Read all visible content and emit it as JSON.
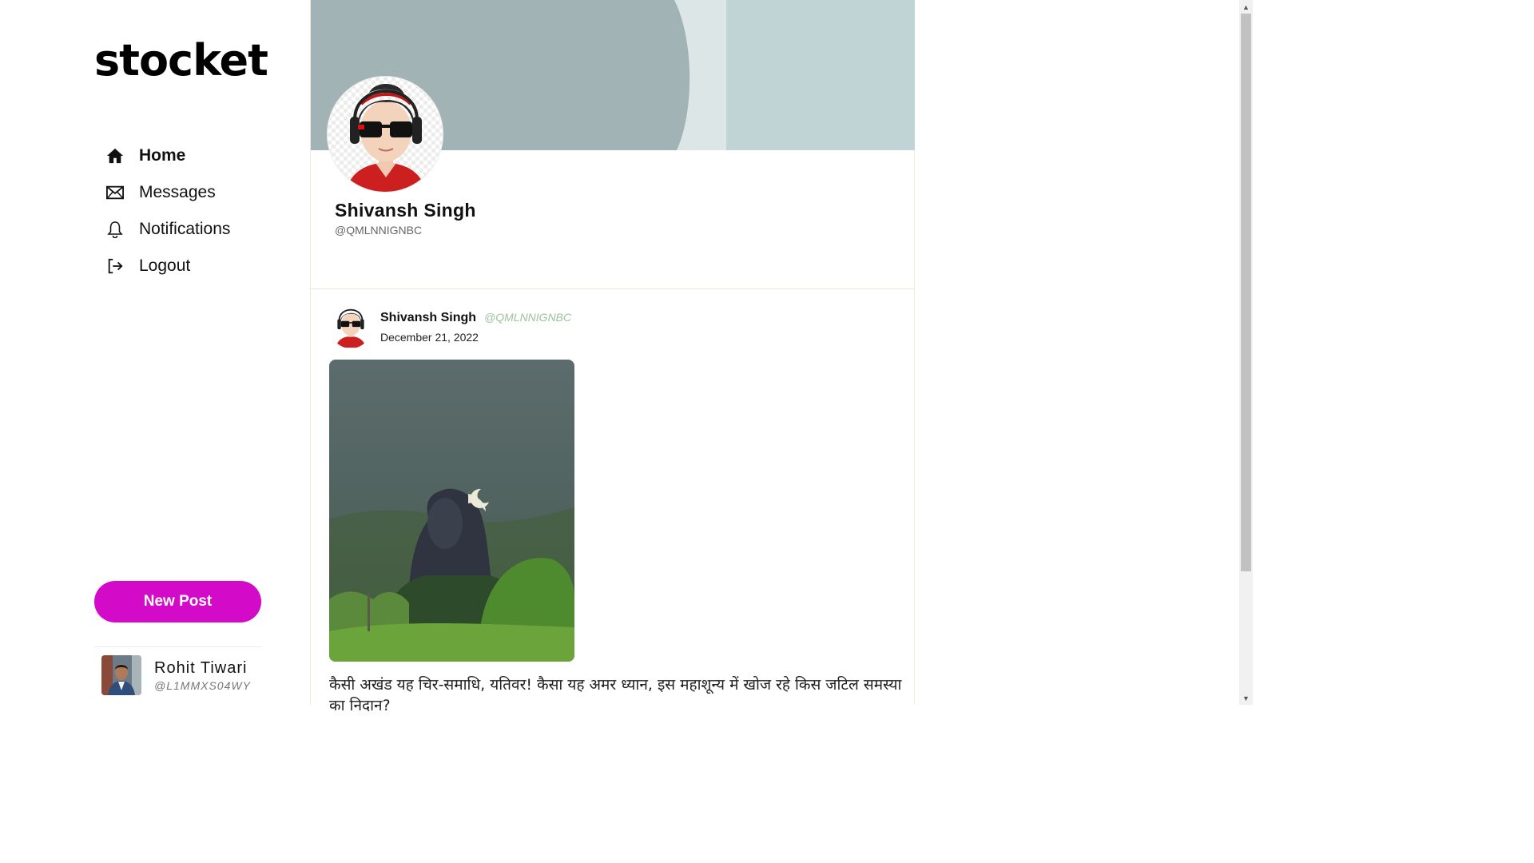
{
  "sidebar": {
    "logo": "stocket",
    "nav": [
      {
        "label": "Home",
        "icon": "home-icon",
        "active": true
      },
      {
        "label": "Messages",
        "icon": "mail-icon",
        "active": false
      },
      {
        "label": "Notifications",
        "icon": "bell-icon",
        "active": false
      },
      {
        "label": "Logout",
        "icon": "logout-icon",
        "active": false
      }
    ],
    "new_post_label": "New Post",
    "current_user": {
      "name": "Rohit Tiwari",
      "handle": "@L1MMXS04WY"
    }
  },
  "profile": {
    "name": "Shivansh Singh",
    "handle": "@QMLNNIGNBC"
  },
  "post": {
    "author_name": "Shivansh Singh",
    "author_handle": "@QMLNNIGNBC",
    "date": "December 21, 2022",
    "text": "कैसी अखंड यह चिर-समाधि, यतिवर! कैसा यह अमर ध्यान, इस महाशून्य में खोज रहे किस जटिल समस्या का निदान?"
  },
  "colors": {
    "accent": "#d30ac8",
    "handle_green": "#9cc39a",
    "cover": "#c0d4d6"
  }
}
